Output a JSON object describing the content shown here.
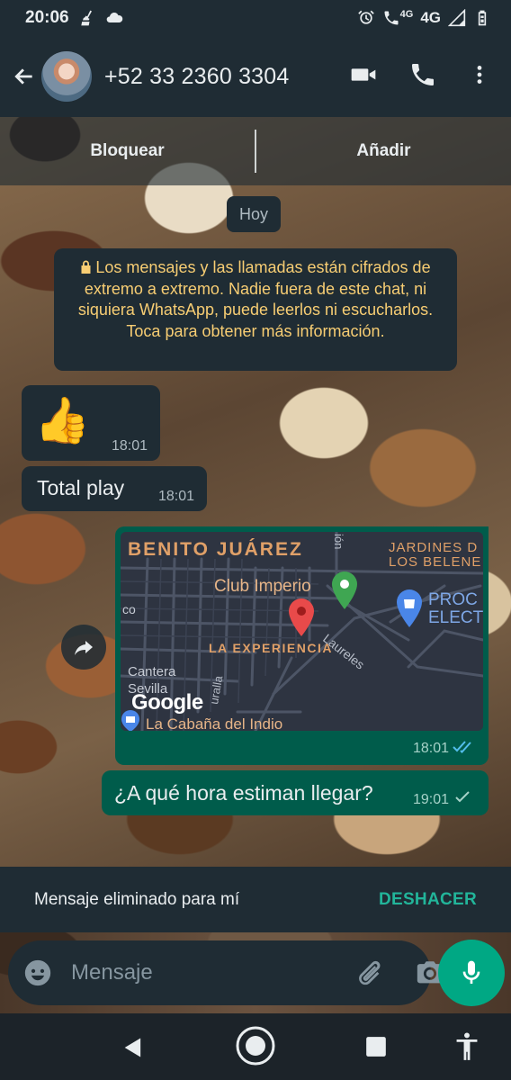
{
  "status_bar": {
    "time": "20:06",
    "network_1": "4G",
    "network_2": "4G",
    "icons": [
      "broom-icon",
      "cloud-icon",
      "alarm-icon",
      "wifi-call-icon",
      "signal-icon",
      "battery-icon"
    ]
  },
  "header": {
    "contact": "+52 33 2360 3304",
    "icons": [
      "back-arrow-icon",
      "avatar",
      "video-call-icon",
      "phone-icon",
      "more-options-icon"
    ]
  },
  "action_bar": {
    "block_label": "Bloquear",
    "add_label": "Añadir"
  },
  "chat": {
    "date_label": "Hoy",
    "encryption_notice": "Los mensajes y las llamadas están cifrados de extremo a extremo. Nadie fuera de este chat, ni siquiera WhatsApp, puede leerlos ni escucharlos. Toca para obtener más información.",
    "messages": [
      {
        "type": "emoji",
        "direction": "in",
        "text": "👍",
        "time": "18:01"
      },
      {
        "type": "text",
        "direction": "in",
        "text": "Total play",
        "time": "18:01"
      },
      {
        "type": "location",
        "direction": "out",
        "time": "18:01",
        "status": "read"
      },
      {
        "type": "text",
        "direction": "out",
        "text": "¿A qué hora estiman llegar?",
        "time": "19:01",
        "status": "sent"
      }
    ]
  },
  "map": {
    "labels": {
      "area": "BENITO JUÁREZ",
      "jardines": "JARDINES D\nLOS BELENE",
      "club": "Club Imperio",
      "experiencia": "LA EXPERIENCIA",
      "proc": "PROC\nELECT",
      "laureles": "Laureles",
      "cantera": "Cantera\nSevilla",
      "co": "co",
      "zion": "ión",
      "turalla": "uralla",
      "google": "Google",
      "cabana": "La Cabaña del Indio"
    },
    "colors": {
      "background": "#2e3441",
      "road": "#4d5566",
      "label": "#e0a068",
      "pin_red": "#e84a4a",
      "pin_green": "#3fa652",
      "pin_blue": "#4a86e8"
    }
  },
  "snackbar": {
    "text": "Mensaje eliminado para mí",
    "action": "DESHACER"
  },
  "composer": {
    "placeholder": "Mensaje"
  },
  "colors": {
    "header_bg": "#1f2c34",
    "bubble_in": "#1f2c34",
    "bubble_out": "#005c4b",
    "accent": "#00a884",
    "encryption_text": "#f7cd73"
  }
}
